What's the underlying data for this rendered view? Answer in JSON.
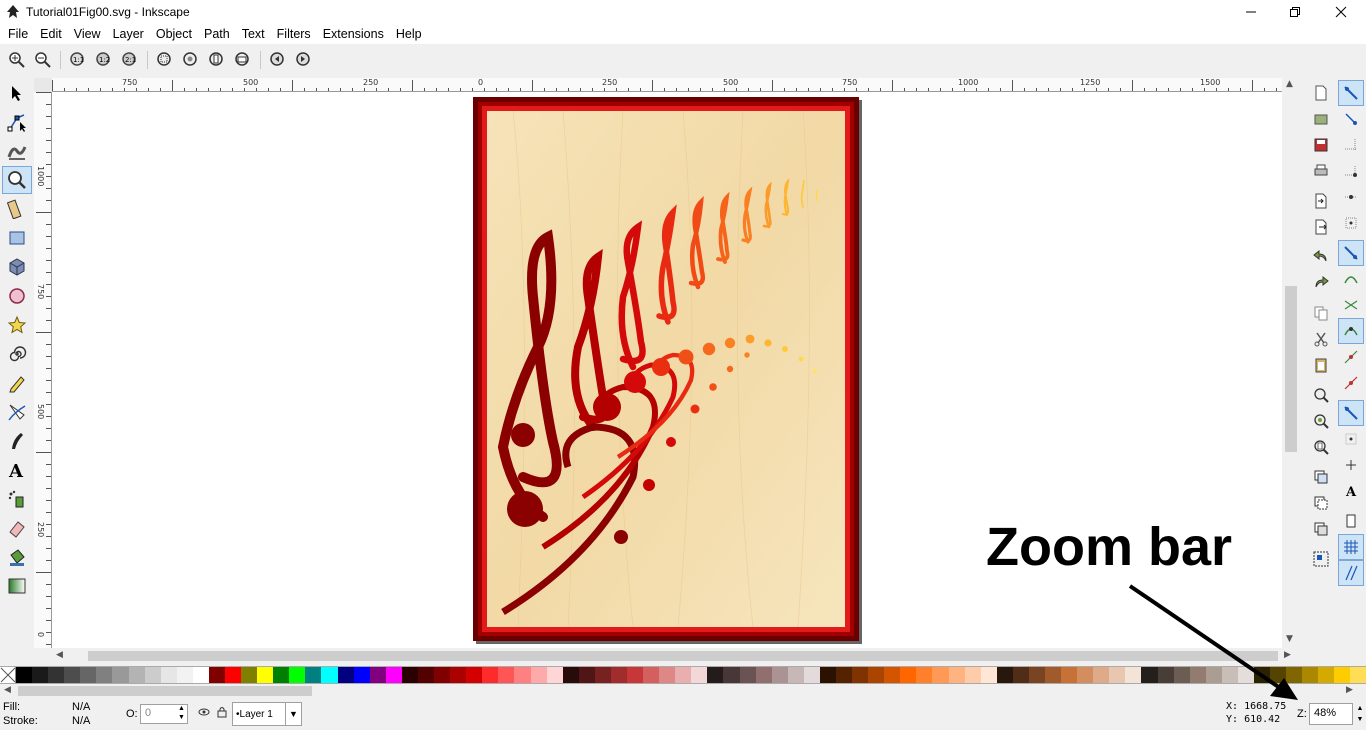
{
  "window": {
    "title": "Tutorial01Fig00.svg - Inkscape",
    "controls": [
      "minimize",
      "maximize",
      "close"
    ]
  },
  "menu": [
    "File",
    "Edit",
    "View",
    "Layer",
    "Object",
    "Path",
    "Text",
    "Filters",
    "Extensions",
    "Help"
  ],
  "command_bar": {
    "icons": [
      "zoom-in-icon",
      "zoom-out-icon",
      "zoom-1to1-icon",
      "zoom-1to2-icon",
      "zoom-2to1-icon",
      "zoom-selection-icon",
      "zoom-drawing-icon",
      "zoom-page-icon",
      "zoom-page-width-icon",
      "zoom-previous-icon",
      "zoom-next-icon"
    ]
  },
  "toolbox": {
    "tools": [
      "selector",
      "node",
      "tweak",
      "zoom",
      "measure",
      "rectangle",
      "3d-box",
      "ellipse",
      "star",
      "spiral",
      "pencil",
      "pen",
      "calligraphy",
      "text",
      "spray",
      "eraser",
      "paint-bucket",
      "gradient"
    ],
    "active": "zoom"
  },
  "rulers": {
    "h_labels": [
      "750",
      "500",
      "250",
      "0",
      "250",
      "500",
      "750",
      "1000",
      "1250",
      "1500"
    ],
    "v_labels": [
      "1000",
      "750",
      "500",
      "250",
      "0"
    ]
  },
  "status": {
    "fill_label": "Fill:",
    "fill_value": "N/A",
    "stroke_label": "Stroke:",
    "stroke_value": "N/A",
    "opacity_label": "O:",
    "opacity_value": "0",
    "layer": "•Layer 1",
    "x_label": "X:",
    "x_value": "1668.75",
    "y_label": "Y:",
    "y_value": "610.42",
    "zoom_label": "Z:",
    "zoom_value": "48%"
  },
  "annotation": {
    "text": "Zoom bar"
  },
  "palette": {
    "colors": [
      "#000000",
      "#1a1a1a",
      "#333333",
      "#4d4d4d",
      "#666666",
      "#808080",
      "#999999",
      "#b3b3b3",
      "#cccccc",
      "#e6e6e6",
      "#f2f2f2",
      "#ffffff",
      "#800000",
      "#ff0000",
      "#808000",
      "#ffff00",
      "#008000",
      "#00ff00",
      "#008080",
      "#00ffff",
      "#000080",
      "#0000ff",
      "#800080",
      "#ff00ff",
      "#2b0000",
      "#550000",
      "#800000",
      "#aa0000",
      "#d40000",
      "#ff2a2a",
      "#ff5555",
      "#ff8080",
      "#ffaaaa",
      "#ffd5d5",
      "#280b0b",
      "#501616",
      "#782121",
      "#a02c2c",
      "#c83737",
      "#d35f5f",
      "#de8787",
      "#e9afaf",
      "#f4d7d7",
      "#241c1c",
      "#483737",
      "#6c5353",
      "#916f6f",
      "#ac9393",
      "#c8b7b7",
      "#e3dbdb",
      "#2b1100",
      "#552200",
      "#803300",
      "#aa4400",
      "#d45500",
      "#ff6600",
      "#ff7f2a",
      "#ff9955",
      "#ffb380",
      "#ffccaa",
      "#ffe6d5",
      "#28170b",
      "#502d16",
      "#784421",
      "#a05a2c",
      "#c87137",
      "#d38d5f",
      "#deaa87",
      "#e9c6af",
      "#f4e3d7",
      "#241f1c",
      "#483e37",
      "#6c5d53",
      "#917c6f",
      "#ac9d93",
      "#c8beb7",
      "#e3dedb",
      "#2b2200",
      "#554400",
      "#806600",
      "#aa8800",
      "#d4aa00",
      "#ffcc00",
      "#ffdd55"
    ]
  },
  "right_commands": [
    "new-document-icon",
    "open-icon",
    "save-icon",
    "print-icon",
    "import-icon",
    "export-icon",
    "undo-icon",
    "redo-icon",
    "copy-icon",
    "cut-icon",
    "paste-icon",
    "zoom-selection-icon",
    "zoom-drawing-icon",
    "zoom-page-icon",
    "duplicate-icon",
    "clone-icon",
    "unlink-clone-icon",
    "group-icon"
  ],
  "snap_controls": [
    "snap-enable-icon",
    "snap-bbox-icon",
    "snap-bbox-edge-icon",
    "snap-bbox-corner-icon",
    "snap-bbox-edge-midpoint-icon",
    "snap-bbox-center-icon",
    "snap-nodes-icon",
    "snap-path-icon",
    "snap-intersection-icon",
    "snap-cusp-icon",
    "snap-smooth-icon",
    "snap-midpoint-icon",
    "snap-others-icon",
    "snap-center-icon",
    "snap-rotation-center-icon",
    "snap-text-baseline-icon",
    "snap-page-border-icon",
    "snap-grid-icon",
    "snap-guide-icon"
  ]
}
